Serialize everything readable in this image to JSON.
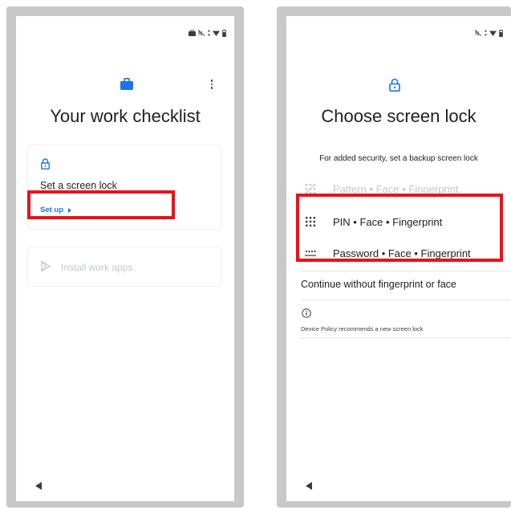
{
  "left": {
    "title": "Your work checklist",
    "screen_lock_card": {
      "label": "Set a screen lock",
      "action_label": "Set up"
    },
    "install_card": {
      "label": "Install work apps"
    }
  },
  "right": {
    "title": "Choose screen lock",
    "subtitle": "For added security, set a backup screen lock",
    "options": [
      {
        "label": "Pattern • Face • Fingerprint",
        "icon": "pattern-icon",
        "disabled": true
      },
      {
        "label": "PIN • Face • Fingerprint",
        "icon": "pin-icon",
        "disabled": false
      },
      {
        "label": "Password • Face • Fingerprint",
        "icon": "password-icon",
        "disabled": false
      }
    ],
    "continue_label": "Continue without fingerprint or face",
    "info_text": "Device Policy recommends a new screen lock"
  },
  "colors": {
    "accent": "#1a73e8",
    "highlight": "#e8121c",
    "frame": "#c8c8c8",
    "disabled": "#c4c7cc"
  }
}
